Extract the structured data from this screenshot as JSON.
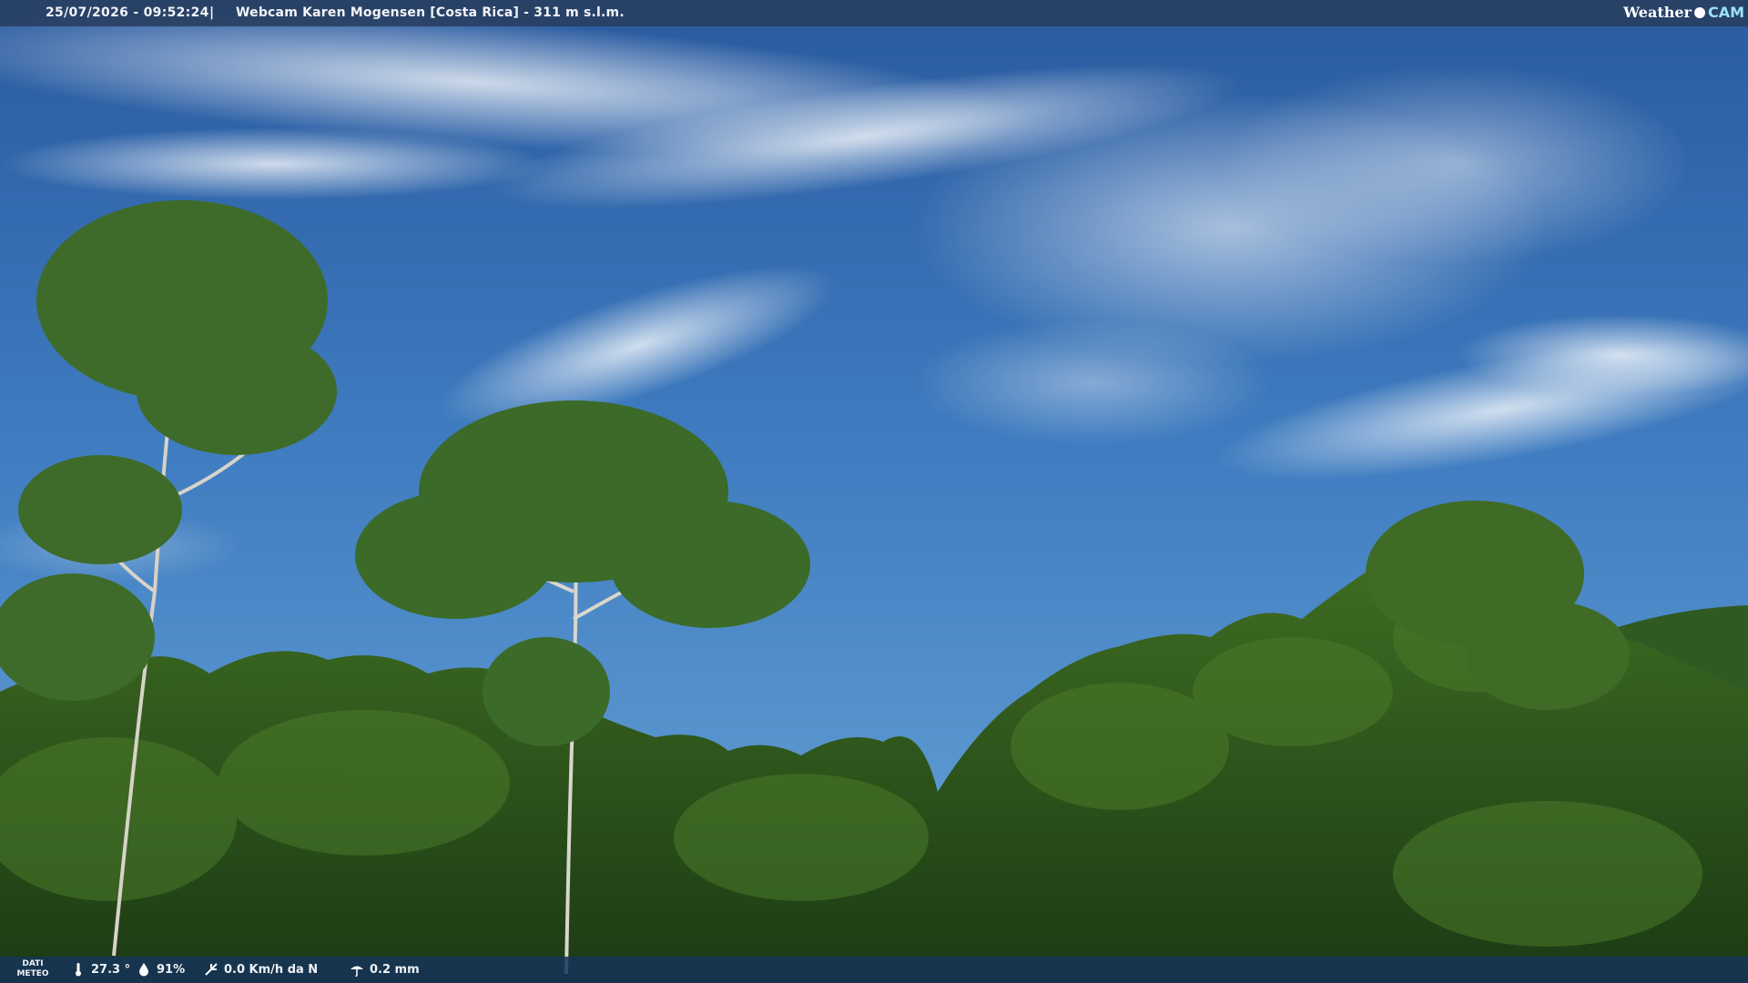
{
  "header": {
    "timestamp": "25/07/2026 - 09:52:24",
    "separator": "|",
    "title": "Webcam Karen Mogensen [Costa Rica]  - 311 m s.l.m.",
    "logo_weather": "Weather",
    "logo_cam": "CAM"
  },
  "footer": {
    "dati_label_1": "DATI",
    "dati_label_2": "METEO",
    "temperature": "27.3 °",
    "humidity": "91%",
    "wind": "0.0 Km/h da N",
    "rain": "0.2 mm",
    "icons": [
      "thermometer-icon",
      "humidity-icon",
      "wind-icon",
      "rain-icon"
    ]
  },
  "colors": {
    "sky_top": "#2a5fa6",
    "sky_bottom": "#5b98d2",
    "foliage_dark": "#1f3f16",
    "foliage_light": "#4f7d2b"
  }
}
